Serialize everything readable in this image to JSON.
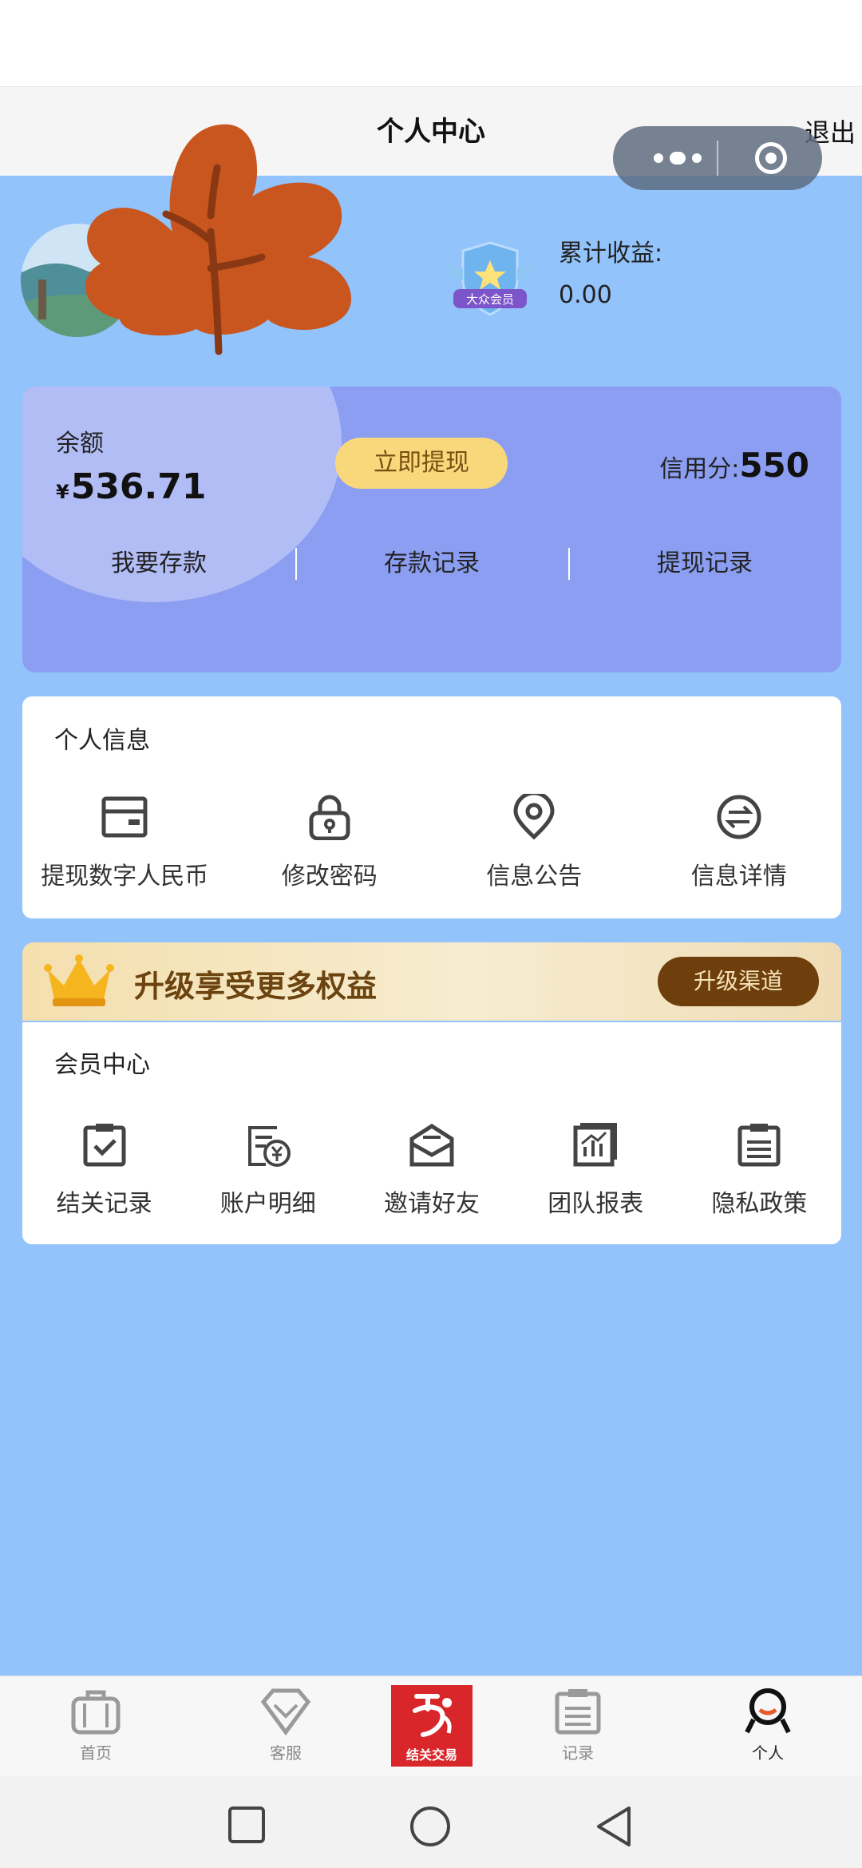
{
  "header": {
    "title": "个人中心",
    "logout_label": "退出"
  },
  "profile": {
    "earnings_label": "累计收益:",
    "earnings_value": "0.00",
    "member_badge_text": "大众会员"
  },
  "balance": {
    "label": "余额",
    "currency": "¥",
    "amount": "536.71",
    "withdraw_button": "立即提现",
    "credit_label": "信用分:",
    "credit_value": "550",
    "actions": [
      "我要存款",
      "存款记录",
      "提现记录"
    ]
  },
  "personal_info": {
    "title": "个人信息",
    "items": [
      {
        "label": "提现数字人民币",
        "icon": "wallet-icon"
      },
      {
        "label": "修改密码",
        "icon": "lock-icon"
      },
      {
        "label": "信息公告",
        "icon": "location-pin-icon"
      },
      {
        "label": "信息详情",
        "icon": "exchange-icon"
      }
    ]
  },
  "upgrade": {
    "text": "升级享受更多权益",
    "button": "升级渠道"
  },
  "member_center": {
    "title": "会员中心",
    "items": [
      {
        "label": "结关记录",
        "icon": "clipboard-check-icon"
      },
      {
        "label": "账户明细",
        "icon": "bill-yen-icon"
      },
      {
        "label": "邀请好友",
        "icon": "mail-icon"
      },
      {
        "label": "团队报表",
        "icon": "bar-chart-icon"
      },
      {
        "label": "隐私政策",
        "icon": "document-list-icon"
      }
    ]
  },
  "tabbar": {
    "items": [
      {
        "label": "首页",
        "icon": "briefcase-icon"
      },
      {
        "label": "客服",
        "icon": "diamond-icon"
      },
      {
        "label": "结关交易",
        "icon": "brand-logo-icon"
      },
      {
        "label": "记录",
        "icon": "clipboard-icon"
      },
      {
        "label": "个人",
        "icon": "person-icon",
        "active": true
      }
    ]
  },
  "colors": {
    "page_bg": "#92c3fb",
    "card_bg": "#8b9ef2",
    "withdraw_btn": "#f9d87c",
    "upgrade_btn": "#6e3f0c",
    "brand_red": "#d9262b"
  }
}
